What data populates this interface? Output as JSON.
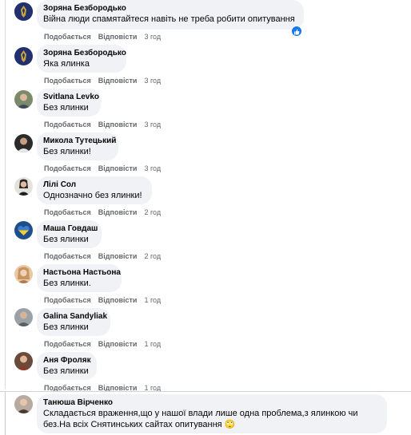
{
  "actions": {
    "like": "Подобається",
    "reply": "Відповісти"
  },
  "colors": {
    "bubble": "#f0f2f5",
    "meta": "#65676b",
    "like_blue": "#1877f2"
  },
  "comments": [
    {
      "author": "Зоряна Безбородько",
      "text": "Війна люди спамятайтеся навіть не треба робити опитування",
      "time": "3 год",
      "avatar": "crest-avatar",
      "reaction": "like-icon"
    },
    {
      "author": "Зоряна Безбородько",
      "text": "Яка ялинка",
      "time": "3 год",
      "avatar": "crest-avatar"
    },
    {
      "author": "Svitlana Levko",
      "text": "Без ялинки",
      "time": "3 год",
      "avatar": "photo-avatar"
    },
    {
      "author": "Микола Тутецький",
      "text": "Без ялинки!",
      "time": "3 год",
      "avatar": "photo-avatar"
    },
    {
      "author": "Лілі Сол",
      "text": "Однозначно без ялинки!",
      "time": "2 год",
      "avatar": "photo-avatar"
    },
    {
      "author": "Маша Говдаш",
      "text": "Без ялинки",
      "time": "2 год",
      "avatar": "heart-avatar"
    },
    {
      "author": "Настьона Настьона",
      "text": "Без ялинки.",
      "time": "1 год",
      "avatar": "photo-avatar"
    },
    {
      "author": "Galina Sandyliak",
      "text": "Без ялинки",
      "time": "1 год",
      "avatar": "photo-avatar"
    },
    {
      "author": "Аня Фроляк",
      "text": "Без ялинки",
      "time": "1 год",
      "avatar": "photo-avatar"
    },
    {
      "author": "Танюша Вірченко",
      "text_line1": "Складається враження,що у нашої влади лише одна проблема,з ялинкою чи",
      "text_line2": "без.На всіх Снятинських сайтах опитування",
      "emoji": "🙄",
      "avatar": "photo-avatar"
    }
  ]
}
